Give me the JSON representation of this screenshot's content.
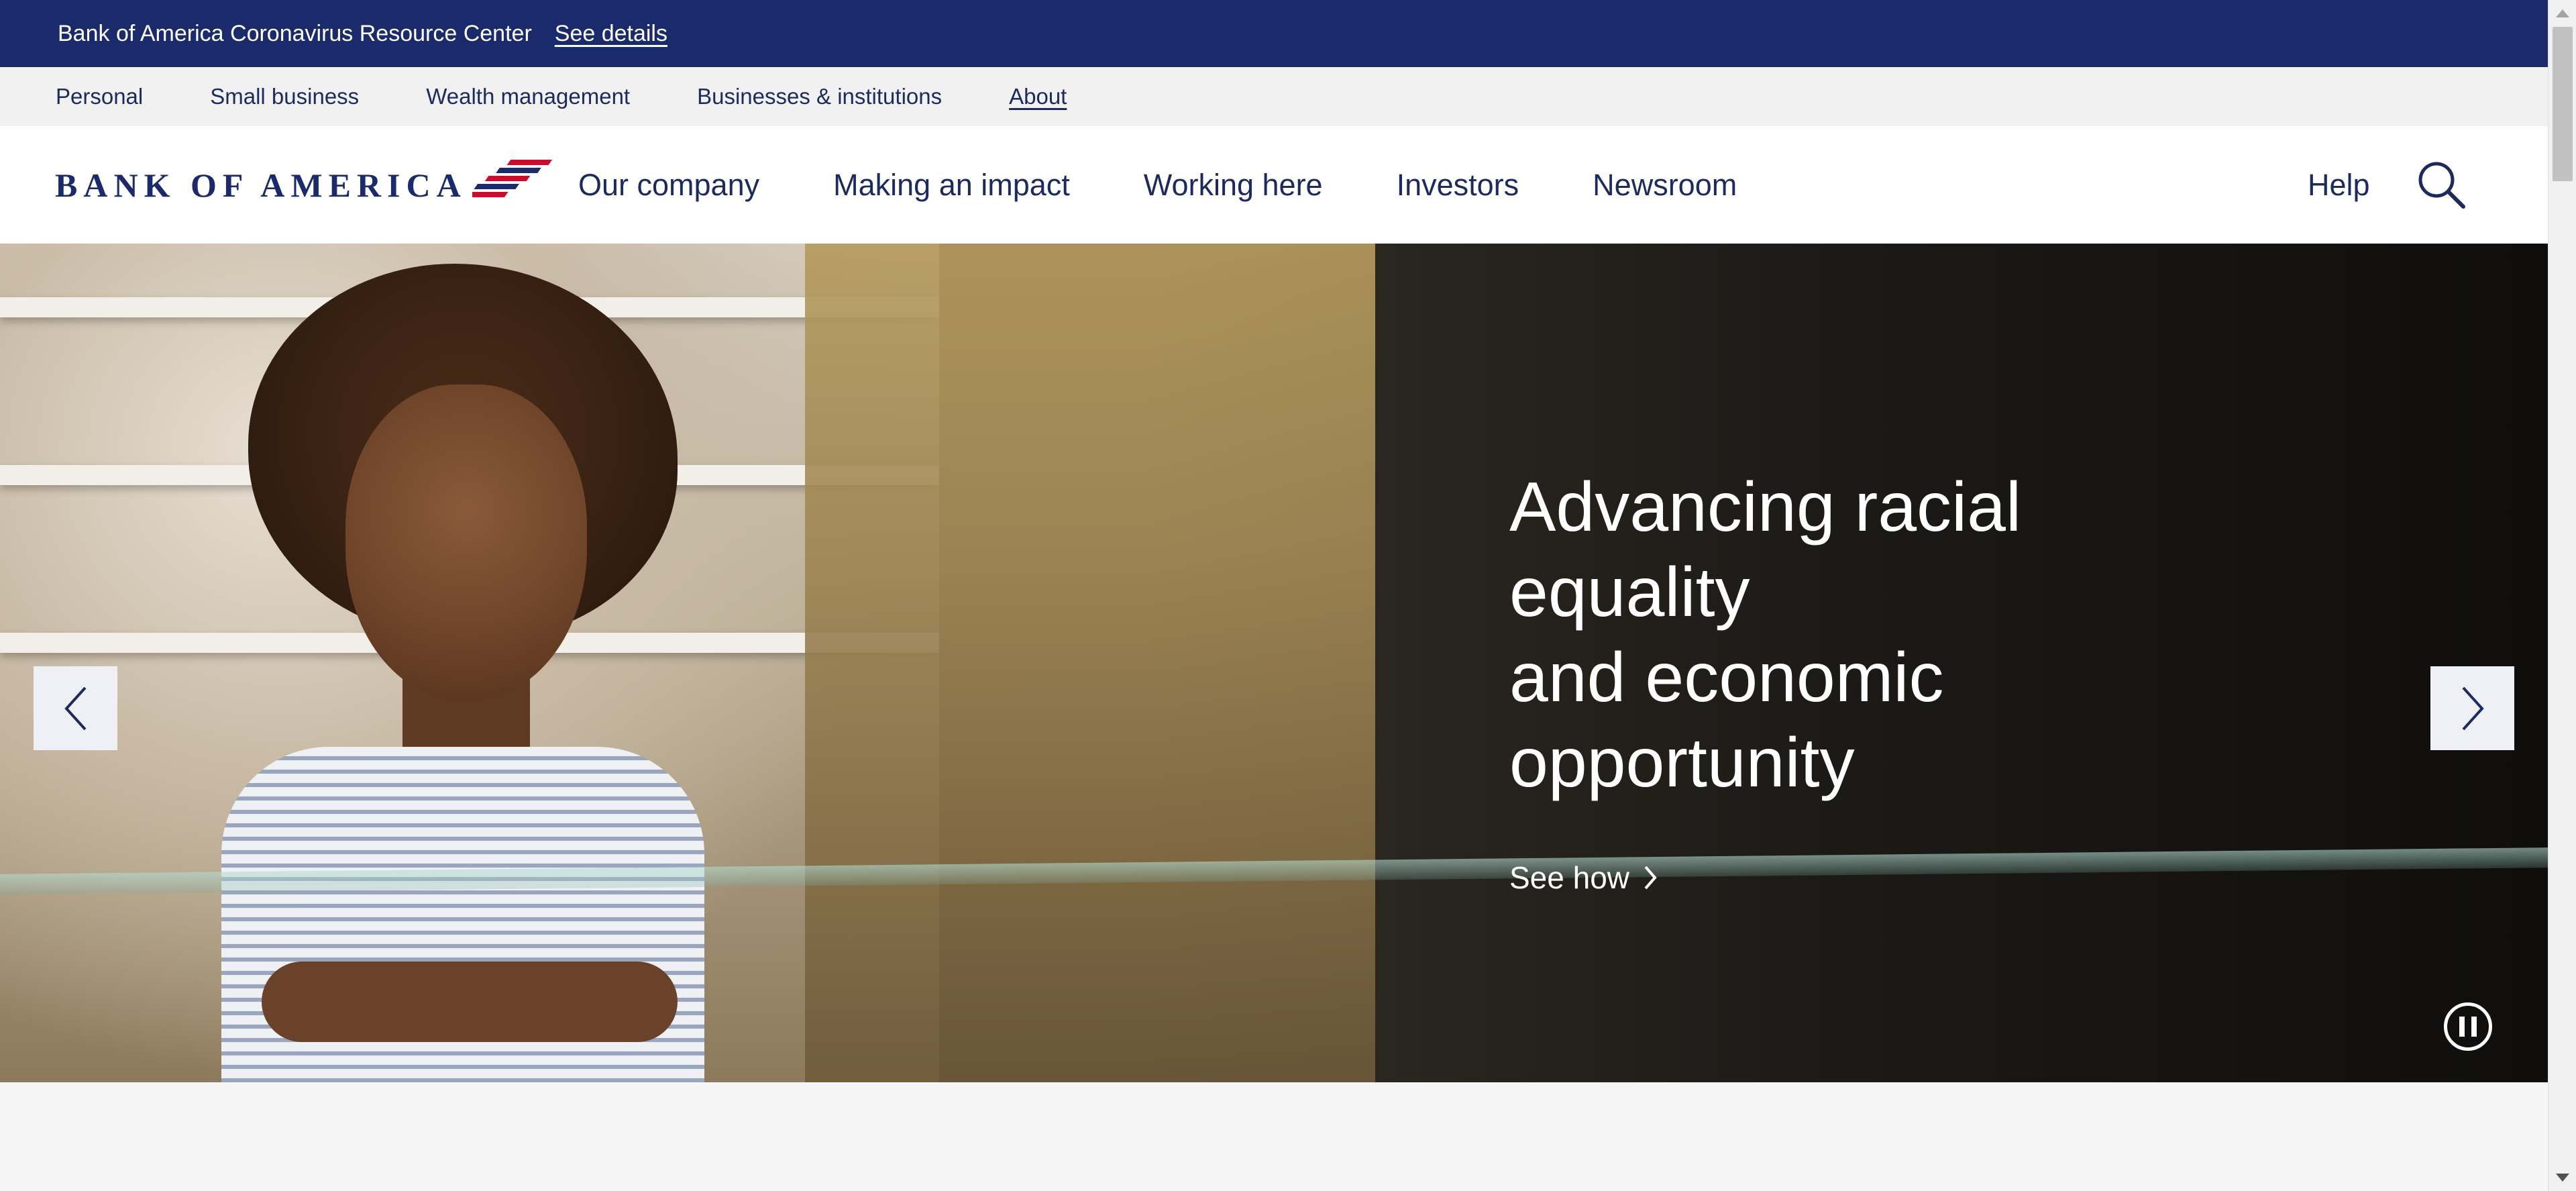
{
  "notice": {
    "text": "Bank of America Coronavirus Resource Center",
    "link": "See details"
  },
  "secondary_nav": {
    "items": [
      {
        "label": "Personal"
      },
      {
        "label": "Small business"
      },
      {
        "label": "Wealth management"
      },
      {
        "label": "Businesses & institutions"
      },
      {
        "label": "About"
      }
    ],
    "active": "About"
  },
  "header": {
    "logo_text": "BANK OF AMERICA",
    "logo_icon": "flag-icon",
    "nav": [
      {
        "label": "Our company"
      },
      {
        "label": "Making an impact"
      },
      {
        "label": "Working here"
      },
      {
        "label": "Investors"
      },
      {
        "label": "Newsroom"
      }
    ],
    "help_label": "Help",
    "search_icon": "search-icon"
  },
  "hero": {
    "title_lines": [
      "Advancing racial equality",
      "and economic",
      "opportunity"
    ],
    "cta_label": "See how",
    "cta_icon": "chevron-right-icon",
    "prev_icon": "chevron-left-icon",
    "next_icon": "chevron-right-icon",
    "pause_icon": "pause-icon"
  },
  "colors": {
    "brand_navy": "#1b2a6b",
    "brand_red": "#c8102e",
    "nav_text": "#1d2a5e"
  }
}
